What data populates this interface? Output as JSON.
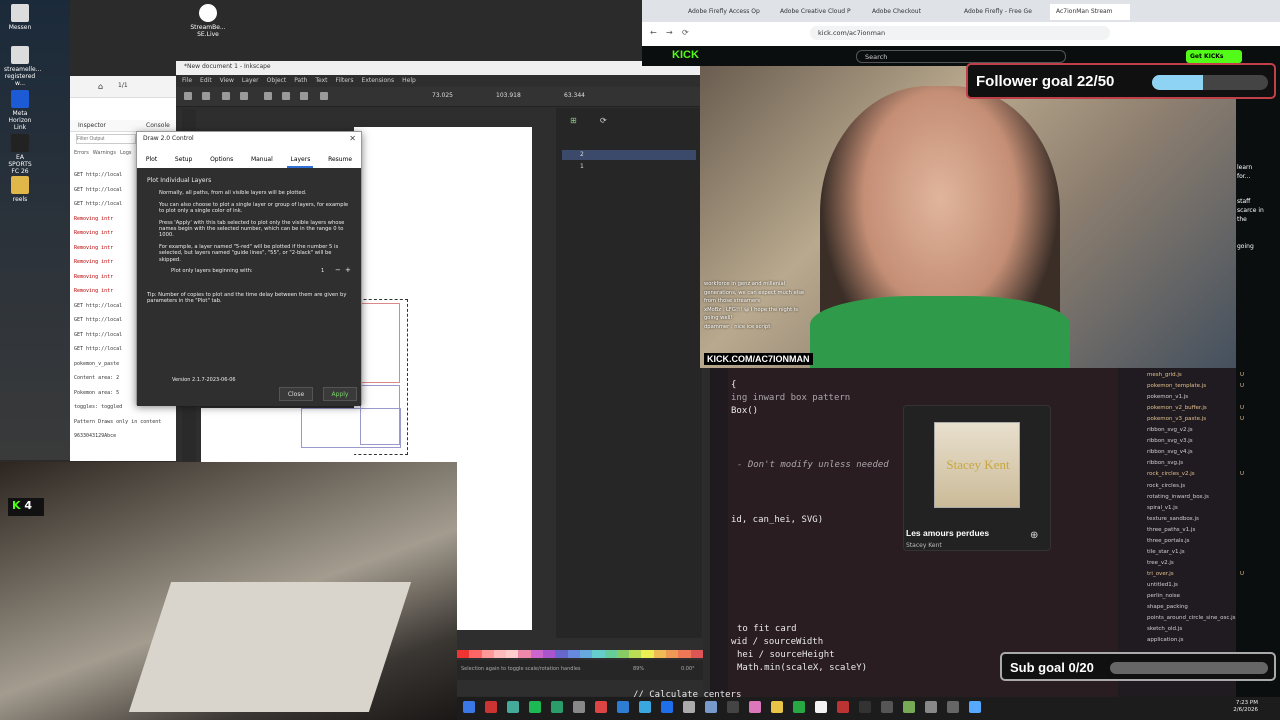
{
  "desktop": {
    "icons": [
      {
        "label": "Messen"
      },
      {
        "label": "streamelle... registered w..."
      },
      {
        "label": "Meta Horizon Link"
      },
      {
        "label": "EA SPORTS FC 26"
      },
      {
        "label": "reels"
      }
    ],
    "widget": {
      "label": "StreamBe... SE.Live"
    }
  },
  "devtools": {
    "tabs": [
      "Inspector",
      "Console"
    ],
    "filter_placeholder": "Filter Output",
    "filters": [
      "Errors",
      "Warnings",
      "Logs"
    ],
    "lines": [
      "GET http://local",
      "GET http://local",
      "GET http://local",
      "Removing intr",
      "Removing intr",
      "Removing intr",
      "Removing intr",
      "Removing intr",
      "Removing intr",
      "GET http://local",
      "GET http://local",
      "GET http://local",
      "GET http://local",
      "pokemon_v_paste",
      "Content area: 2",
      "Pokemon area: 5",
      "toggles: toggled",
      "Pattern Draws only in content",
      "9633043129Abce"
    ]
  },
  "inkscape": {
    "title": "*New document 1 - Inkscape",
    "menu": [
      "File",
      "Edit",
      "View",
      "Layer",
      "Object",
      "Path",
      "Text",
      "Filters",
      "Extensions",
      "Help"
    ],
    "toolbar": {
      "x": "73.025",
      "y": "103.918",
      "w": "63.344"
    },
    "layers": [
      "2",
      "1"
    ],
    "status_hint": "Selection again to toggle scale/rotation handles",
    "coords": "113.82\n156.21",
    "zoom": "89%",
    "rotation": "0.00°"
  },
  "dialog": {
    "title": "Draw 2.0 Control",
    "tabs": [
      "Plot",
      "Setup",
      "Options",
      "Manual",
      "Layers",
      "Resume"
    ],
    "active_tab": "Layers",
    "heading": "Plot Individual Layers",
    "para1": "Normally, all paths, from all visible layers will be plotted.",
    "para2": "You can also choose to plot a single layer or group of layers, for example to plot only a single color of ink.",
    "para3": "Press 'Apply' with this tab selected to plot only the visible layers whose names begin with the selected number, which can be in the range 0 to 1000.",
    "para4": "For example, a layer named \"5-red\" will be plotted if the number 5 is selected, but layers named \"guide lines\", \"55\", or \"2-black\" will be skipped.",
    "plot_label": "Plot only layers beginning with:",
    "plot_value": "1",
    "tip": "Tip: Number of copies to plot and the time delay between them are given by parameters in the \"Plot\" tab.",
    "version": "Version 2.1.7-2023-06-06",
    "close_label": "Close",
    "apply_label": "Apply"
  },
  "chrome": {
    "tabs": [
      "Adobe Firefly Access Op",
      "Adobe Creative Cloud P",
      "Adobe Checkout",
      "Adobe Firefly - Free Ge",
      "Ac7ionMan Stream"
    ],
    "tab_subtitle": "PICTURE-IN-PICTURE",
    "url": "kick.com/ac7ionman"
  },
  "kick": {
    "search_placeholder": "Search",
    "get_kicks": "Get KICKs",
    "follower_goal": "Follower goal 22/50",
    "follower_progress": 0.44,
    "sub_goal": "Sub goal 0/20",
    "sub_progress": 0,
    "overlay_brand": "KICK.COM/AC7IONMAN",
    "chat": [
      "workforce in genz and millenial",
      "generations, we can expect much else",
      "from those streamers",
      "xMoBz : LFG!!! 😄 I hope the night is",
      "going well!",
      "dpammer : nice ice script"
    ],
    "side_chat": [
      "learn",
      "for...",
      "staff",
      "scarce in",
      "the",
      "going"
    ]
  },
  "spotify": {
    "track": "Les amours perdues",
    "artist": "Stacey Kent",
    "cover_text": "Stacey Kent"
  },
  "vscode": {
    "lines": [
      "{",
      "ing inward box pattern",
      "Box()",
      "- Don't modify unless needed",
      "id, can_hei, SVG)",
      "to fit card",
      "wid / sourceWidth",
      "hei / sourceHeight",
      "Math.min(scaleX, scaleY)",
      "// Calculate centers"
    ],
    "files": [
      "mesh_grid.js",
      "pokemon_template.js",
      "pokemon_v1.js",
      "pokemon_v2_buffer.js",
      "pokemon_v3_paste.js",
      "ribbon_svg_v2.js",
      "ribbon_svg_v3.js",
      "ribbon_svg_v4.js",
      "ribbon_svg.js",
      "rock_circles_v2.js",
      "rock_circles.js",
      "rotating_inward_box.js",
      "spiral_v1.js",
      "texture_sandbox.js",
      "three_paths_v1.js",
      "three_portals.js",
      "tile_star_v1.js",
      "tree_v2.js",
      "tri_over.js",
      "untitled1.js",
      "perlin_noise",
      "shape_packing",
      "points_around_circle_sine_osc.js",
      "sketch_old.js",
      "application.js"
    ],
    "file_status": [
      "U",
      "U",
      "",
      "U",
      "U",
      "",
      "",
      "",
      "",
      "U",
      "",
      "",
      "",
      "",
      "",
      "",
      "",
      "",
      "U",
      "",
      "",
      "",
      "",
      "",
      ""
    ]
  },
  "bottom_cam": {
    "badge": "4"
  },
  "taskbar": {
    "time": "7:23 PM",
    "date": "2/6/2026"
  },
  "colors": {
    "kick_green": "#53fc18",
    "goal_bar": "#8fd3f4",
    "inkscape_bg": "#2e2e2e",
    "vscode_bg": "#2a1d22"
  }
}
